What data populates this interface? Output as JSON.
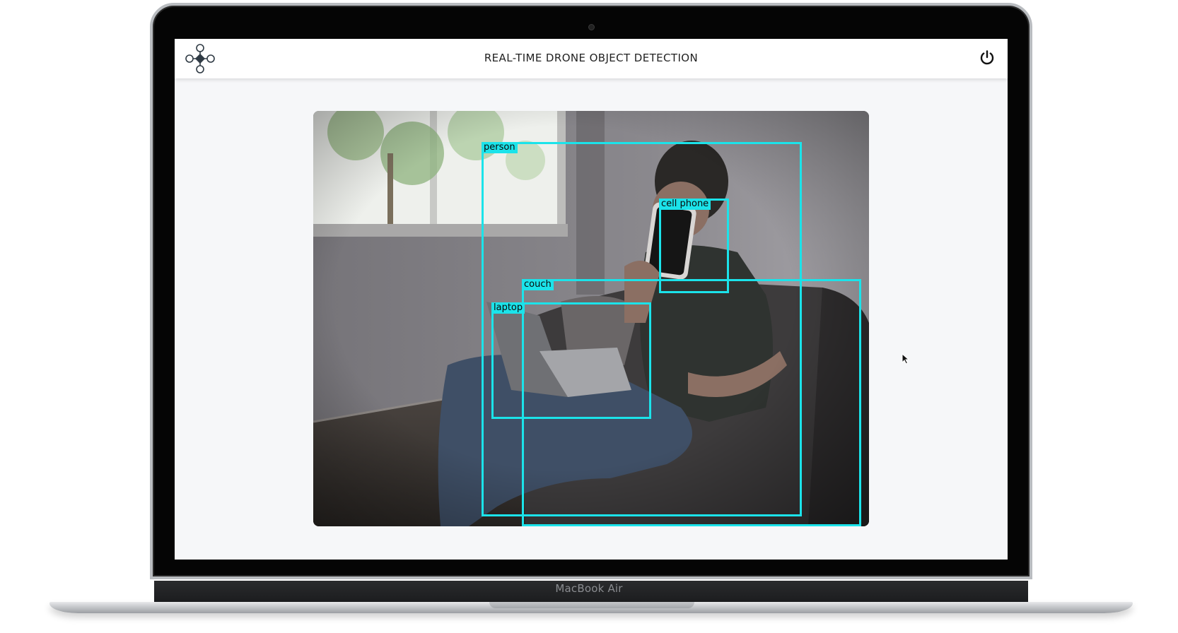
{
  "device": {
    "brand_label": "MacBook Air"
  },
  "app": {
    "title": "REAL-TIME DRONE OBJECT DETECTION",
    "logo_icon": "drone-icon",
    "power_icon": "power-icon",
    "accent_color": "#1be3ea"
  },
  "video": {
    "detections": [
      {
        "label": "person"
      },
      {
        "label": "cell phone"
      },
      {
        "label": "couch"
      },
      {
        "label": "laptop"
      }
    ]
  }
}
